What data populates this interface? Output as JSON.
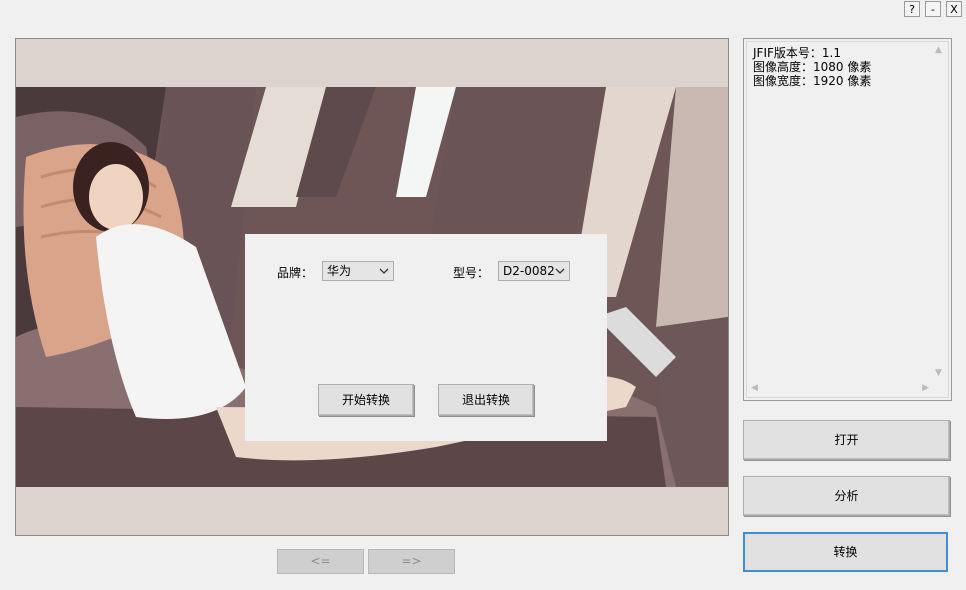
{
  "window_controls": {
    "help": "?",
    "minimize": "-",
    "close": "X"
  },
  "info_panel": {
    "lines": [
      "JFIF版本号：1.1",
      "图像高度：1080 像素",
      "图像宽度：1920 像素"
    ]
  },
  "dialog": {
    "brand_label": "品牌：",
    "brand_value": "华为",
    "model_label": "型号：",
    "model_value": "D2-0082",
    "start_button": "开始转换",
    "exit_button": "退出转换"
  },
  "side_buttons": {
    "open": "打开",
    "analyze": "分析",
    "convert": "转换"
  },
  "nav": {
    "prev": "<=",
    "next": "=>"
  }
}
